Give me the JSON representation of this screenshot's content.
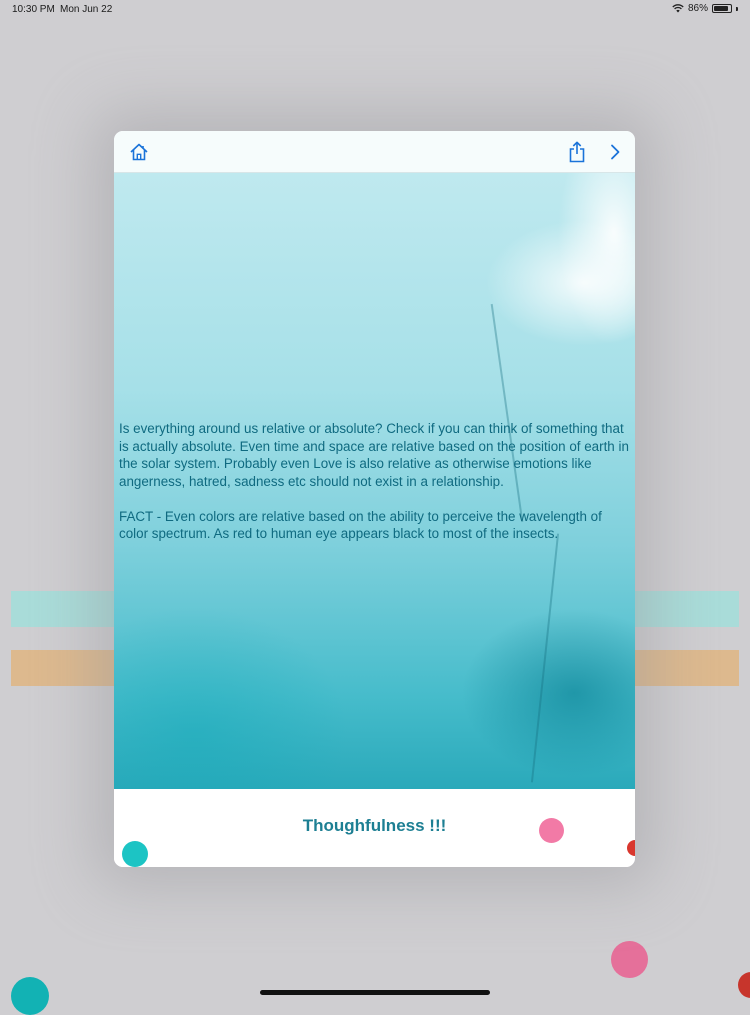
{
  "status_bar": {
    "time": "10:30 PM",
    "date": "Mon Jun 22",
    "battery_percent": "86%",
    "battery_level": 0.86,
    "wifi_icon": "wifi-icon",
    "battery_icon": "battery-icon"
  },
  "toolbar": {
    "home_icon": "home-icon",
    "share_icon": "share-icon",
    "next_icon": "chevron-right-icon",
    "accent_color": "#1a73d9"
  },
  "content": {
    "paragraph_1": "Is everything around us relative or absolute? Check if you can think of something that is actually absolute. Even time and space are relative based on the position of earth in the solar system. Probably even Love is also relative as otherwise emotions like angerness, hatred, sadness etc should not exist in a relationship.",
    "paragraph_2": "FACT - Even colors are relative based on the ability to perceive the wavelength of color spectrum. As red to human eye appears black to most of the insects.",
    "text_color": "#0f6a80"
  },
  "footer": {
    "title": "Thoughfulness !!!",
    "title_color": "#1d7f93"
  },
  "colors": {
    "background": "#cfced1",
    "teal_strip": "#a9dcd9",
    "tan_strip": "#ddb98e",
    "teal_dot": "#1cc4c4",
    "pink_dot": "#f27aa6",
    "red_dot": "#d9372e"
  }
}
